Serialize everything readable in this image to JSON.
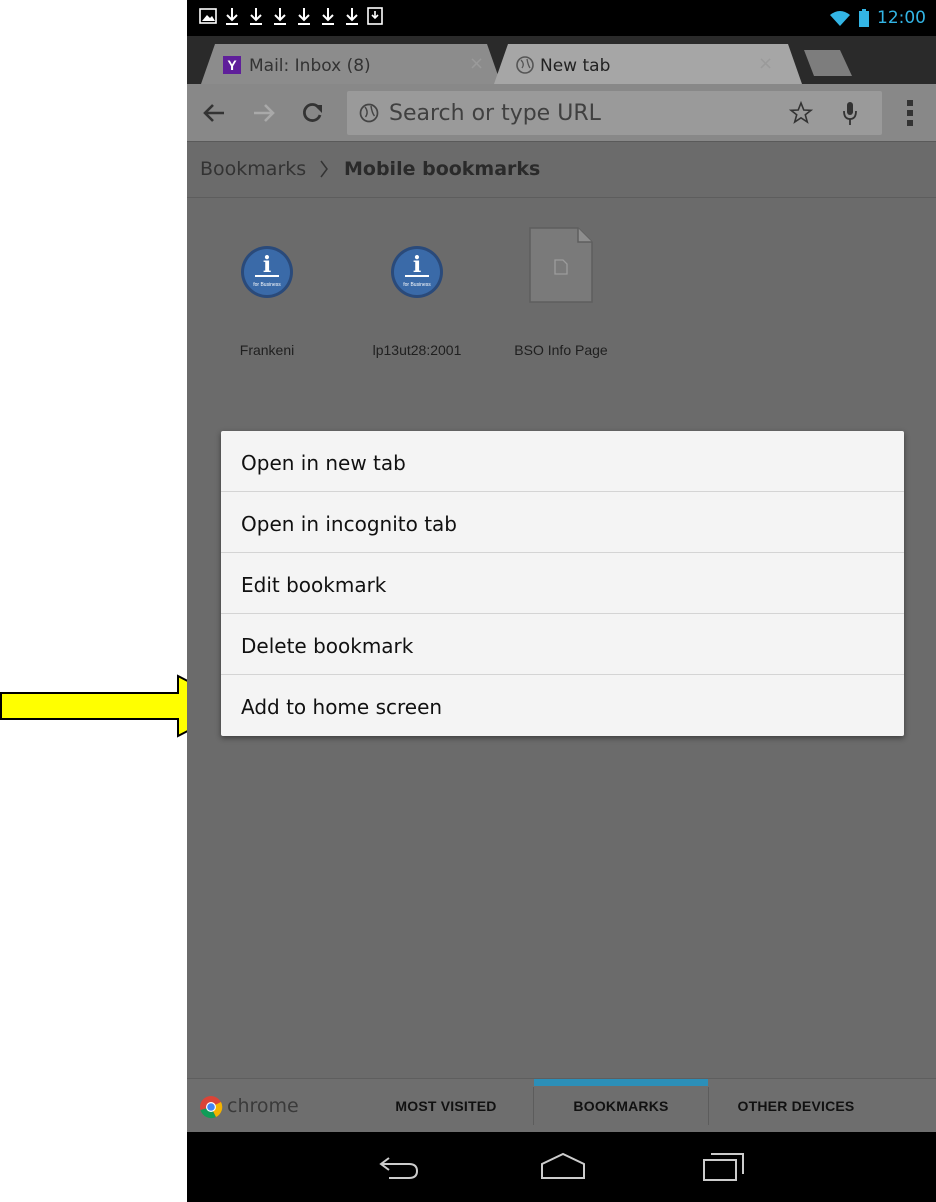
{
  "status_bar": {
    "time": "12:00",
    "notification_icons": [
      "image-icon",
      "download-icon",
      "download-icon",
      "download-icon",
      "download-icon",
      "download-icon",
      "download-icon",
      "download-complete-icon"
    ],
    "wifi_icon": "wifi-icon",
    "battery_icon": "battery-icon",
    "accent_color": "#33b5e5"
  },
  "tabs": [
    {
      "label": "Mail: Inbox (8)",
      "favicon": "yahoo-y-icon",
      "favicon_color": "#5f1f9a",
      "active": false
    },
    {
      "label": "New tab",
      "favicon": "globe-icon",
      "active": true
    }
  ],
  "toolbar": {
    "omnibox_placeholder": "Search or type URL",
    "icons": [
      "back-arrow-icon",
      "forward-arrow-icon",
      "reload-icon",
      "globe-icon",
      "star-icon",
      "microphone-icon",
      "overflow-menu-icon"
    ]
  },
  "breadcrumb": {
    "root": "Bookmarks",
    "current": "Mobile bookmarks"
  },
  "bookmarks": [
    {
      "title": "Frankeni",
      "icon": "ibm-i-for-business-icon",
      "icon_text": "for Business"
    },
    {
      "title": "lp13ut28:2001",
      "icon": "ibm-i-for-business-icon",
      "icon_text": "for Business"
    },
    {
      "title": "BSO Info Page",
      "icon": "document-page-icon"
    }
  ],
  "context_menu": {
    "items": [
      "Open in new tab",
      "Open in incognito tab",
      "Edit bookmark",
      "Delete bookmark",
      "Add to home screen"
    ]
  },
  "bottom_tabs": {
    "brand": "chrome",
    "items": [
      {
        "label": "MOST VISITED",
        "selected": false
      },
      {
        "label": "BOOKMARKS",
        "selected": true
      },
      {
        "label": "OTHER DEVICES",
        "selected": false
      }
    ],
    "selected_color": "#2c8fb8"
  },
  "nav_bar": {
    "icons": [
      "back-icon",
      "home-icon",
      "recent-apps-icon"
    ]
  },
  "annotation": {
    "arrow_color": "#ffff00",
    "points_to": "Add to home screen"
  }
}
